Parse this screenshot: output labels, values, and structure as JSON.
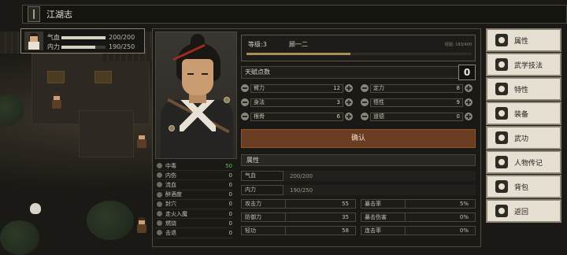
{
  "topbar": {
    "title": "江湖志"
  },
  "party": {
    "hp_label": "气血",
    "hp_value": "200/200",
    "hp_frac": 1.0,
    "mp_label": "内力",
    "mp_value": "190/250",
    "mp_frac": 0.76
  },
  "level": {
    "label": "等级:3",
    "name": "顾一二",
    "exp": "经验: 183/400",
    "exp_frac": 0.46
  },
  "talent": {
    "label": "天赋点数",
    "value": "0"
  },
  "points": [
    {
      "name": "臂力",
      "value": "12"
    },
    {
      "name": "定力",
      "value": "8"
    },
    {
      "name": "身法",
      "value": "3"
    },
    {
      "name": "悟性",
      "value": "9"
    },
    {
      "name": "根骨",
      "value": "6"
    },
    {
      "name": "道德",
      "value": "0"
    }
  ],
  "confirm": "确认",
  "attr": {
    "header": "属性",
    "hp_label": "气血",
    "hp_value": "200/200",
    "mp_label": "内力",
    "mp_value": "190/250"
  },
  "stats": [
    {
      "name": "攻击力",
      "value": "55"
    },
    {
      "name": "暴击率",
      "value": "5%"
    },
    {
      "name": "防御力",
      "value": "35"
    },
    {
      "name": "暴击伤害",
      "value": "0%"
    },
    {
      "name": "轻功",
      "value": "58"
    },
    {
      "name": "连击率",
      "value": "0%"
    }
  ],
  "status": [
    {
      "name": "中毒",
      "value": "50"
    },
    {
      "name": "内伤",
      "value": "0"
    },
    {
      "name": "流血",
      "value": "0"
    },
    {
      "name": "醉酒度",
      "value": "0"
    },
    {
      "name": "封穴",
      "value": "0"
    },
    {
      "name": "走火入魔",
      "value": "0"
    },
    {
      "name": "燃烧",
      "value": "0"
    },
    {
      "name": "击退",
      "value": "0"
    }
  ],
  "menu": [
    {
      "label": "属性",
      "icon": "person-icon"
    },
    {
      "label": "武学技法",
      "icon": "martial-icon"
    },
    {
      "label": "特性",
      "icon": "trait-icon"
    },
    {
      "label": "装备",
      "icon": "sword-icon"
    },
    {
      "label": "武功",
      "icon": "scroll-icon"
    },
    {
      "label": "人物传记",
      "icon": "book-icon"
    },
    {
      "label": "背包",
      "icon": "bag-icon"
    },
    {
      "label": "返回",
      "icon": "door-icon"
    }
  ]
}
